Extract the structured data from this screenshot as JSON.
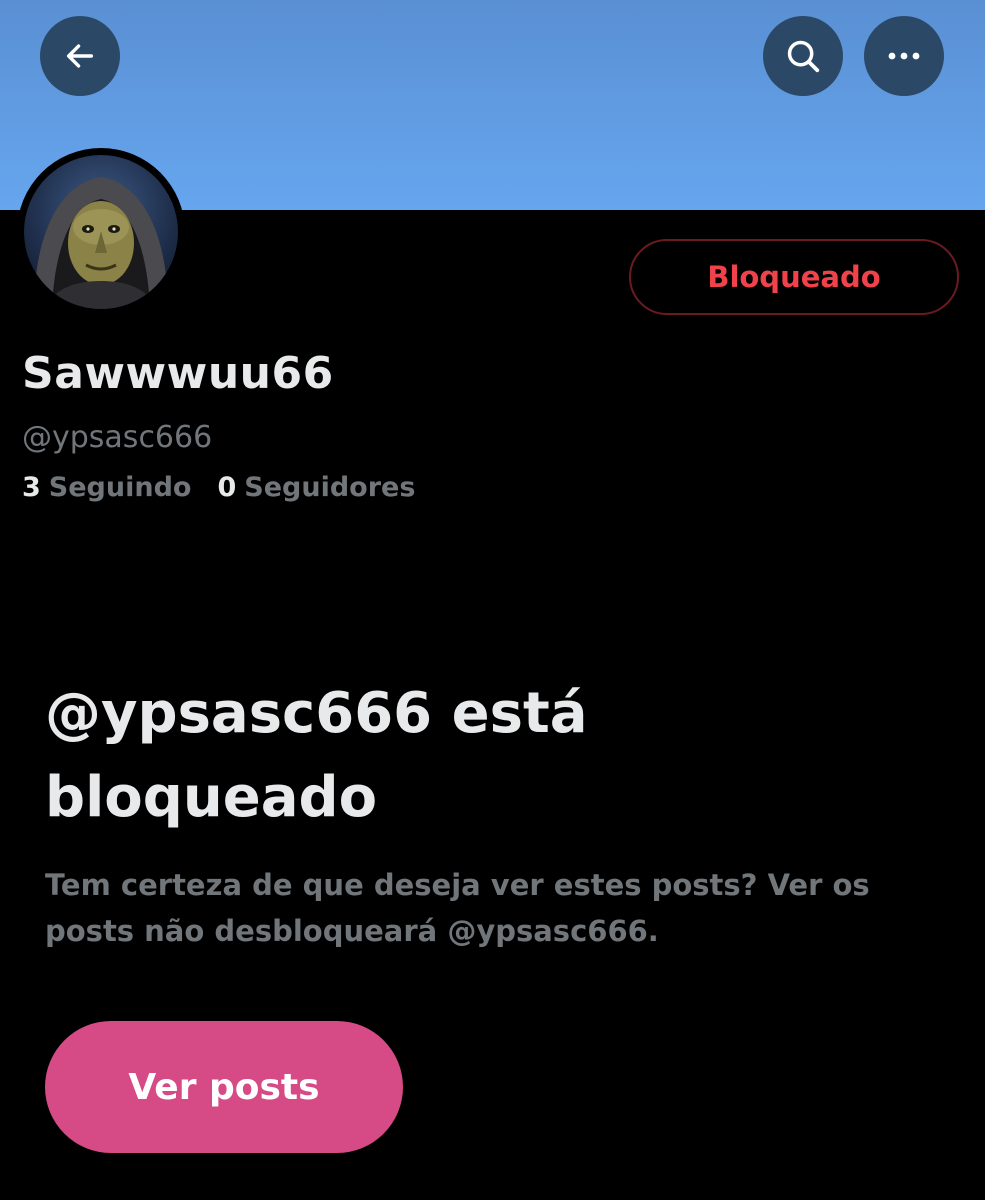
{
  "header": {
    "back_icon": "arrow-left-icon",
    "search_icon": "search-icon",
    "more_icon": "more-horizontal-icon",
    "banner_color": "#66a6ee"
  },
  "profile": {
    "display_name": "Sawwwuu66",
    "handle": "@ypsasc666",
    "block_button_label": "Bloqueado",
    "following_count": "3",
    "following_label": "Seguindo",
    "followers_count": "0",
    "followers_label": "Seguidores"
  },
  "blocked_notice": {
    "title": "@ypsasc666 está bloqueado",
    "description": "Tem certeza de que deseja ver estes posts? Ver os posts não desbloqueará @ypsasc666.",
    "view_button_label": "Ver posts"
  },
  "colors": {
    "background": "#000000",
    "blocked_red": "#f0424a",
    "view_button": "#d64a86",
    "secondary_text": "#71767b",
    "primary_text": "#e7e9ea"
  }
}
